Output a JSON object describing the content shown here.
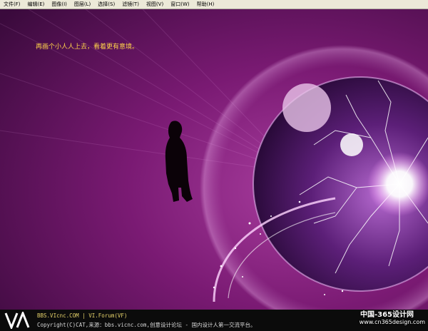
{
  "menu": {
    "items": [
      "文件(F)",
      "编辑(E)",
      "图像(I)",
      "图层(L)",
      "选择(S)",
      "滤镜(T)",
      "视图(V)",
      "窗口(W)",
      "帮助(H)"
    ]
  },
  "canvas": {
    "caption": "再画个小人人上去，看着更有意境。"
  },
  "footer": {
    "line1": "BBS.VIcnc.COM | VI.Forum(VF)",
    "line2": "Copyright(C)CAT,来源：bbs.vicnc.com,创意设计论坛 - 国内设计人第一交流平台。"
  },
  "watermark": {
    "line1": "中国-365设计网",
    "line2": "www.cn365design.com"
  },
  "colors": {
    "caption": "#ffd34a",
    "background": "#6a1566",
    "glow": "#ffffff"
  }
}
